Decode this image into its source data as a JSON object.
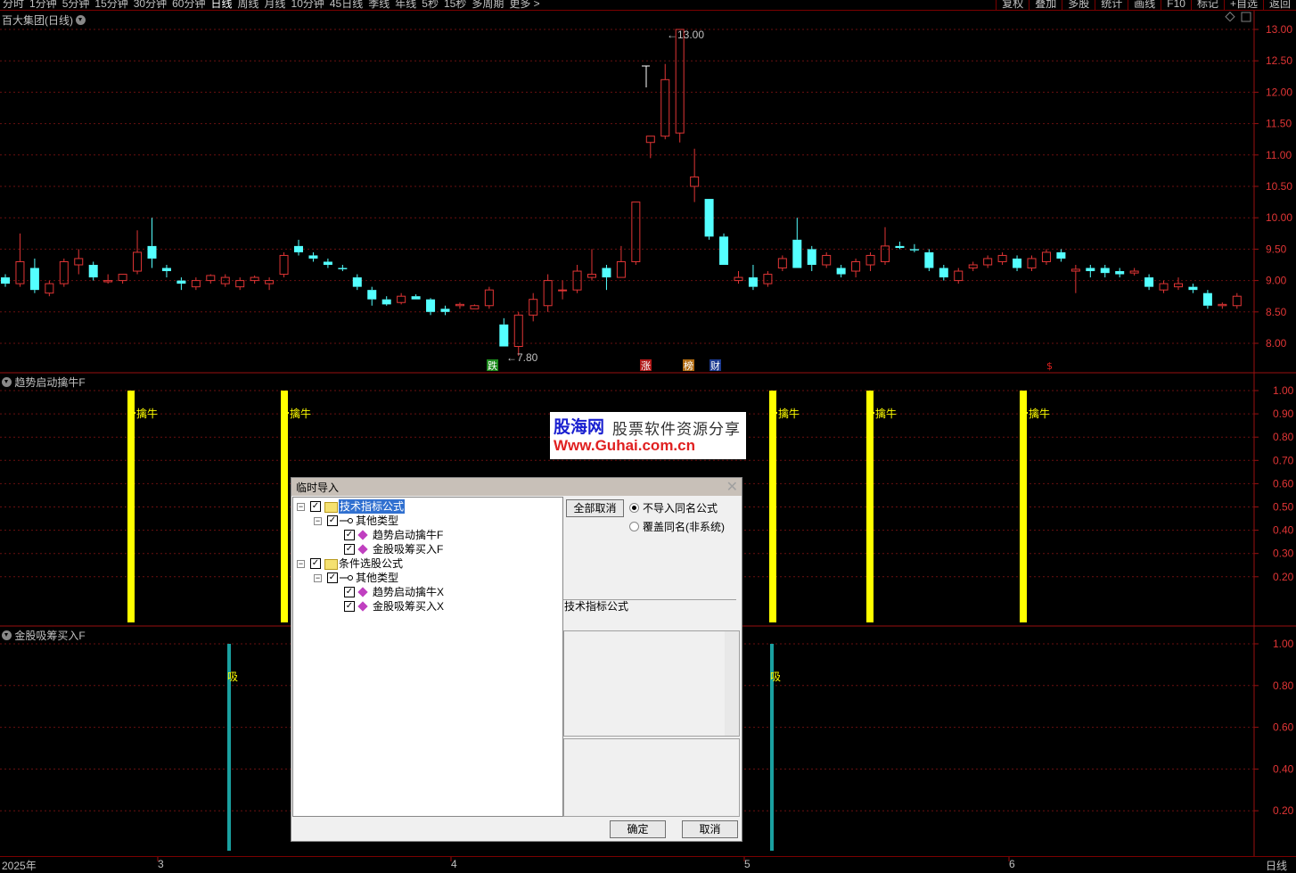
{
  "toolbar": {
    "periods": [
      "分时",
      "1分钟",
      "5分钟",
      "15分钟",
      "30分钟",
      "60分钟",
      "日线",
      "周线",
      "月线",
      "10分钟",
      "45日线",
      "季线",
      "年线",
      "5秒",
      "15秒",
      "多周期",
      "更多 >"
    ],
    "active_period": "日线",
    "right_buttons": [
      "复权",
      "叠加",
      "多股",
      "统计",
      "画线",
      "F10",
      "标记",
      "+自选",
      "返回"
    ]
  },
  "main_chart": {
    "title": "百大集团(日线)",
    "price_high_label": "13.00",
    "price_low_label": "7.80",
    "price_axis": [
      "13.00",
      "12.50",
      "12.00",
      "11.50",
      "11.00",
      "10.50",
      "10.00",
      "9.50",
      "9.00",
      "8.50",
      "8.00"
    ],
    "badges": [
      {
        "text": "跌",
        "color": "#1c8a1c"
      },
      {
        "text": "涨",
        "color": "#b01818"
      },
      {
        "text": "榜",
        "color": "#b06a10"
      },
      {
        "text": "财",
        "color": "#1c3a90"
      },
      {
        "text": "$",
        "color": "#e02020"
      }
    ]
  },
  "indicator1": {
    "title": "趋势启动擒牛F",
    "signal_label": "擒牛",
    "axis": [
      "1.00",
      "0.90",
      "0.80",
      "0.70",
      "0.60",
      "0.50",
      "0.40",
      "0.30",
      "0.20"
    ]
  },
  "indicator2": {
    "title": "金股吸筹买入F",
    "signal_label": "吸",
    "axis": [
      "1.00",
      "0.80",
      "0.60",
      "0.40",
      "0.20"
    ]
  },
  "bottom": {
    "dates": [
      "2025年",
      "3",
      "4",
      "5",
      "6"
    ],
    "period_label": "日线"
  },
  "watermark": {
    "line1_a": "股海网",
    "line1_b": "股票软件资源分享",
    "line2": "Www.Guhai.com.cn"
  },
  "dialog": {
    "title": "临时导入",
    "close": "✕",
    "tree": [
      {
        "label": "技术指标公式",
        "level": 0,
        "icon": "folder-icon",
        "selected": true
      },
      {
        "label": "其他类型",
        "level": 1,
        "icon": "key-icon"
      },
      {
        "label": "趋势启动擒牛F",
        "level": 2,
        "icon": "diamond-icon"
      },
      {
        "label": "金股吸筹买入F",
        "level": 2,
        "icon": "diamond-icon"
      },
      {
        "label": "条件选股公式",
        "level": 0,
        "icon": "folder-icon"
      },
      {
        "label": "其他类型",
        "level": 1,
        "icon": "key-icon"
      },
      {
        "label": "趋势启动擒牛X",
        "level": 2,
        "icon": "diamond-icon"
      },
      {
        "label": "金股吸筹买入X",
        "level": 2,
        "icon": "diamond-icon"
      }
    ],
    "cancel_all": "全部取消",
    "radio_no_import": "不导入同名公式",
    "radio_overwrite": "覆盖同名(非系统)",
    "info_label": "技术指标公式",
    "ok": "确定",
    "cancel": "取消"
  }
}
